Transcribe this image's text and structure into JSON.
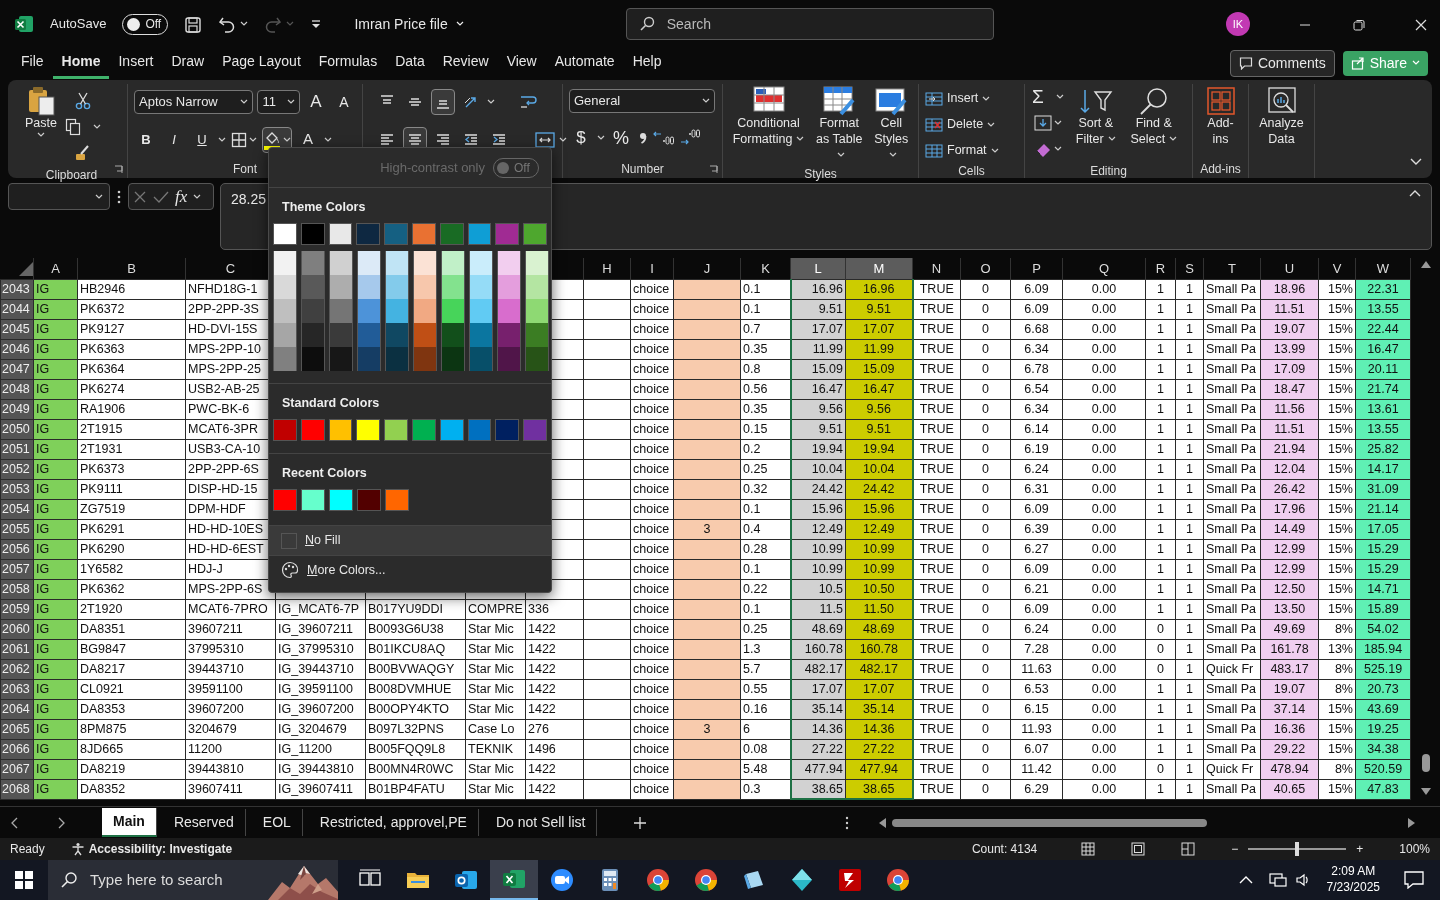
{
  "title_bar": {
    "autosave_label": "AutoSave",
    "autosave": {
      "on": false,
      "label": "Off"
    },
    "file_name": "Imran Price file",
    "search": {
      "placeholder": "Search"
    },
    "avatar": "IK"
  },
  "menu_tabs": [
    {
      "label": "File",
      "selected": false
    },
    {
      "label": "Home",
      "selected": true
    },
    {
      "label": "Insert",
      "selected": false
    },
    {
      "label": "Draw",
      "selected": false
    },
    {
      "label": "Page Layout",
      "selected": false
    },
    {
      "label": "Formulas",
      "selected": false
    },
    {
      "label": "Data",
      "selected": false
    },
    {
      "label": "Review",
      "selected": false
    },
    {
      "label": "View",
      "selected": false
    },
    {
      "label": "Automate",
      "selected": false
    },
    {
      "label": "Help",
      "selected": false
    }
  ],
  "header_buttons": {
    "comments": "Comments",
    "share": "Share"
  },
  "ribbon": {
    "clipboard": {
      "paste": "Paste",
      "group": "Clipboard"
    },
    "font": {
      "name": "Aptos Narrow",
      "size": "11",
      "grow": "A",
      "shrink": "A",
      "bold": "B",
      "italic": "I",
      "underline": "U",
      "font_color": "A",
      "fill_menu_open": true,
      "group": "Font"
    },
    "alignment": {
      "buttons": [
        {
          "kind": "top",
          "selected": false
        },
        {
          "kind": "middle",
          "selected": false
        },
        {
          "kind": "bottom",
          "selected": true
        },
        {
          "kind": "orientation",
          "selected": false
        },
        {
          "kind": "left",
          "selected": false
        },
        {
          "kind": "center",
          "selected": true
        },
        {
          "kind": "right",
          "selected": false
        },
        {
          "kind": "outdent",
          "selected": false
        },
        {
          "kind": "indent",
          "selected": false
        }
      ]
    },
    "number": {
      "format": "General",
      "currency": "$",
      "percent": "%",
      "group": "Number"
    },
    "styles": {
      "buttons": [
        "Conditional Formatting",
        "Format as Table",
        "Cell Styles"
      ],
      "group": "Styles"
    },
    "cells": {
      "buttons": [
        "Insert",
        "Delete",
        "Format"
      ],
      "group": "Cells"
    },
    "editing": {
      "sum": "Σ",
      "buttons": [
        "Sort & Filter",
        "Find & Select"
      ],
      "group": "Editing"
    },
    "addins": {
      "button": "Add-ins",
      "group": "Add-ins"
    },
    "analyze": {
      "button": "Analyze Data"
    }
  },
  "formula_bar": {
    "fx": "fx",
    "value": "28.25"
  },
  "fill_color_menu": {
    "high_contrast": {
      "label": "High-contrast only",
      "on": false,
      "state": "Off",
      "disabled": true
    },
    "theme_heading": "Theme Colors",
    "theme_colors": [
      {
        "color": "#ffffff",
        "shades": [
          {
            "color": "#f2f2f2"
          },
          {
            "color": "#d9d9d9"
          },
          {
            "color": "#bfbfbf"
          },
          {
            "color": "#a6a6a6"
          },
          {
            "color": "#808080"
          }
        ]
      },
      {
        "color": "#000000",
        "shades": [
          {
            "color": "#7f7f7f"
          },
          {
            "color": "#595959"
          },
          {
            "color": "#404040"
          },
          {
            "color": "#262626"
          },
          {
            "color": "#0d0d0d"
          }
        ]
      },
      {
        "color": "#e8e8e8",
        "shades": [
          {
            "color": "#d0d0d0"
          },
          {
            "color": "#adadad"
          },
          {
            "color": "#757575"
          },
          {
            "color": "#3a3a3a"
          },
          {
            "color": "#171717"
          }
        ]
      },
      {
        "color": "#0e2841",
        "shades": [
          {
            "color": "#dceaf7"
          },
          {
            "color": "#a6c9ec"
          },
          {
            "color": "#4d93d9"
          },
          {
            "color": "#215c98"
          },
          {
            "color": "#153d64"
          }
        ]
      },
      {
        "color": "#156082",
        "shades": [
          {
            "color": "#c0e4f5"
          },
          {
            "color": "#83cbeb"
          },
          {
            "color": "#44b3e1"
          },
          {
            "color": "#104862"
          },
          {
            "color": "#0b3041"
          }
        ]
      },
      {
        "color": "#e97132",
        "shades": [
          {
            "color": "#fbe2d5"
          },
          {
            "color": "#f7c7ac"
          },
          {
            "color": "#f1a983"
          },
          {
            "color": "#c04f15"
          },
          {
            "color": "#7f3510"
          }
        ]
      },
      {
        "color": "#196b24",
        "shades": [
          {
            "color": "#c1f0c8"
          },
          {
            "color": "#83e28e"
          },
          {
            "color": "#47d45a"
          },
          {
            "color": "#124f1b"
          },
          {
            "color": "#0c3512"
          }
        ]
      },
      {
        "color": "#0f9ed5",
        "shades": [
          {
            "color": "#caedfb"
          },
          {
            "color": "#95dcf7"
          },
          {
            "color": "#61cbf3"
          },
          {
            "color": "#0b76a0"
          },
          {
            "color": "#074f69"
          }
        ]
      },
      {
        "color": "#a02b93",
        "shades": [
          {
            "color": "#f2ceef"
          },
          {
            "color": "#e49edd"
          },
          {
            "color": "#d86dcd"
          },
          {
            "color": "#77206d"
          },
          {
            "color": "#501549"
          }
        ]
      },
      {
        "color": "#4ea72e",
        "shades": [
          {
            "color": "#d9f2d0"
          },
          {
            "color": "#b4e5a2"
          },
          {
            "color": "#8ed973"
          },
          {
            "color": "#3b7d23"
          },
          {
            "color": "#275317"
          }
        ]
      }
    ],
    "standard_heading": "Standard Colors",
    "standard_colors": [
      {
        "color": "#c00000"
      },
      {
        "color": "#ff0000"
      },
      {
        "color": "#ffc000"
      },
      {
        "color": "#ffff00"
      },
      {
        "color": "#92d050"
      },
      {
        "color": "#00b050"
      },
      {
        "color": "#00b0f0"
      },
      {
        "color": "#0070c0"
      },
      {
        "color": "#002060"
      },
      {
        "color": "#7030a0"
      }
    ],
    "recent_heading": "Recent Colors",
    "recent_colors": [
      {
        "color": "#ff0000"
      },
      {
        "color": "#66ffcc"
      },
      {
        "color": "#00ffff"
      },
      {
        "color": "#520000"
      },
      {
        "color": "#ff6600"
      }
    ],
    "no_fill": "No Fill",
    "more_colors": "More Colors..."
  },
  "sheet": {
    "columns": [
      {
        "label": "A",
        "selected": false,
        "color": "#7fd05a"
      },
      {
        "label": "B",
        "selected": false
      },
      {
        "label": "C",
        "selected": false
      },
      {},
      {},
      {},
      {},
      {
        "label": "H",
        "selected": false
      },
      {
        "label": "I",
        "selected": false
      },
      {
        "label": "J",
        "selected": false,
        "color": "#f8cbad"
      },
      {
        "label": "K",
        "selected": false
      },
      {
        "label": "L",
        "selected": true
      },
      {
        "label": "M",
        "selected": true,
        "color": "#cccc00"
      },
      {
        "label": "N",
        "selected": false
      },
      {
        "label": "O",
        "selected": false
      },
      {
        "label": "P",
        "selected": false
      },
      {
        "label": "Q",
        "selected": false
      },
      {
        "label": "R",
        "selected": false
      },
      {
        "label": "S",
        "selected": false
      },
      {
        "label": "T",
        "selected": false
      },
      {
        "label": "U",
        "selected": false,
        "color": "#f0cff0"
      },
      {
        "label": "V",
        "selected": false
      },
      {
        "label": "W",
        "selected": false,
        "color": "#5ff0b4"
      }
    ],
    "rows": [
      {
        "number": "2043",
        "cells": [
          "IG",
          "HB2946",
          "NFHD18G-1",
          null,
          null,
          null,
          null,
          null,
          "choice",
          null,
          "0.1",
          "16.96",
          "16.96",
          "TRUE",
          "0",
          "6.09",
          "0.00",
          "1",
          "1",
          "Small Pa",
          "18.96",
          "15%",
          "22.31"
        ]
      },
      {
        "number": "2044",
        "cells": [
          "IG",
          "PK6372",
          "2PP-2PP-3S",
          null,
          null,
          null,
          null,
          null,
          "choice",
          null,
          "0.1",
          "9.51",
          "9.51",
          "TRUE",
          "0",
          "6.09",
          "0.00",
          "1",
          "1",
          "Small Pa",
          "11.51",
          "15%",
          "13.55"
        ]
      },
      {
        "number": "2045",
        "cells": [
          "IG",
          "PK9127",
          "HD-DVI-15S",
          null,
          null,
          null,
          null,
          null,
          "choice",
          null,
          "0.7",
          "17.07",
          "17.07",
          "TRUE",
          "0",
          "6.68",
          "0.00",
          "1",
          "1",
          "Small Pa",
          "19.07",
          "15%",
          "22.44"
        ]
      },
      {
        "number": "2046",
        "cells": [
          "IG",
          "PK6363",
          "MPS-2PP-10",
          null,
          null,
          null,
          null,
          null,
          "choice",
          null,
          "0.35",
          "11.99",
          "11.99",
          "TRUE",
          "0",
          "6.34",
          "0.00",
          "1",
          "1",
          "Small Pa",
          "13.99",
          "15%",
          "16.47"
        ]
      },
      {
        "number": "2047",
        "cells": [
          "IG",
          "PK6364",
          "MPS-2PP-25",
          null,
          null,
          null,
          null,
          null,
          "choice",
          null,
          "0.8",
          "15.09",
          "15.09",
          "TRUE",
          "0",
          "6.78",
          "0.00",
          "1",
          "1",
          "Small Pa",
          "17.09",
          "15%",
          "20.11"
        ]
      },
      {
        "number": "2048",
        "cells": [
          "IG",
          "PK6274",
          "USB2-AB-25",
          null,
          null,
          null,
          null,
          null,
          "choice",
          null,
          "0.56",
          "16.47",
          "16.47",
          "TRUE",
          "0",
          "6.54",
          "0.00",
          "1",
          "1",
          "Small Pa",
          "18.47",
          "15%",
          "21.74"
        ]
      },
      {
        "number": "2049",
        "cells": [
          "IG",
          "RA1906",
          "PWC-BK-6",
          null,
          null,
          null,
          null,
          null,
          "choice",
          null,
          "0.35",
          "9.56",
          "9.56",
          "TRUE",
          "0",
          "6.34",
          "0.00",
          "1",
          "1",
          "Small Pa",
          "11.56",
          "15%",
          "13.61"
        ]
      },
      {
        "number": "2050",
        "cells": [
          "IG",
          "2T1915",
          "MCAT6-3PR",
          null,
          null,
          null,
          null,
          null,
          "choice",
          null,
          "0.15",
          "9.51",
          "9.51",
          "TRUE",
          "0",
          "6.14",
          "0.00",
          "1",
          "1",
          "Small Pa",
          "11.51",
          "15%",
          "13.55"
        ]
      },
      {
        "number": "2051",
        "cells": [
          "IG",
          "2T1931",
          "USB3-CA-10",
          null,
          null,
          null,
          null,
          null,
          "choice",
          null,
          "0.2",
          "19.94",
          "19.94",
          "TRUE",
          "0",
          "6.19",
          "0.00",
          "1",
          "1",
          "Small Pa",
          "21.94",
          "15%",
          "25.82"
        ]
      },
      {
        "number": "2052",
        "cells": [
          "IG",
          "PK6373",
          "2PP-2PP-6S",
          null,
          null,
          null,
          null,
          null,
          "choice",
          null,
          "0.25",
          "10.04",
          "10.04",
          "TRUE",
          "0",
          "6.24",
          "0.00",
          "1",
          "1",
          "Small Pa",
          "12.04",
          "15%",
          "14.17"
        ]
      },
      {
        "number": "2053",
        "cells": [
          "IG",
          "PK9111",
          "DISP-HD-15",
          null,
          null,
          null,
          null,
          null,
          "choice",
          null,
          "0.32",
          "24.42",
          "24.42",
          "TRUE",
          "0",
          "6.31",
          "0.00",
          "1",
          "1",
          "Small Pa",
          "26.42",
          "15%",
          "31.09"
        ]
      },
      {
        "number": "2054",
        "cells": [
          "IG",
          "ZG7519",
          "DPM-HDF",
          null,
          null,
          null,
          null,
          null,
          "choice",
          null,
          "0.1",
          "15.96",
          "15.96",
          "TRUE",
          "0",
          "6.09",
          "0.00",
          "1",
          "1",
          "Small Pa",
          "17.96",
          "15%",
          "21.14"
        ]
      },
      {
        "number": "2055",
        "cells": [
          "IG",
          "PK6291",
          "HD-HD-10ES",
          null,
          null,
          null,
          null,
          null,
          "choice",
          "3",
          "0.4",
          "12.49",
          "12.49",
          "TRUE",
          "0",
          "6.39",
          "0.00",
          "1",
          "1",
          "Small Pa",
          "14.49",
          "15%",
          "17.05"
        ]
      },
      {
        "number": "2056",
        "cells": [
          "IG",
          "PK6290",
          "HD-HD-6EST",
          null,
          null,
          null,
          null,
          null,
          "choice",
          null,
          "0.28",
          "10.99",
          "10.99",
          "TRUE",
          "0",
          "6.27",
          "0.00",
          "1",
          "1",
          "Small Pa",
          "12.99",
          "15%",
          "15.29"
        ]
      },
      {
        "number": "2057",
        "cells": [
          "IG",
          "1Y6582",
          "HDJ-J",
          null,
          null,
          null,
          null,
          null,
          "choice",
          null,
          "0.1",
          "10.99",
          "10.99",
          "TRUE",
          "0",
          "6.09",
          "0.00",
          "1",
          "1",
          "Small Pa",
          "12.99",
          "15%",
          "15.29"
        ]
      },
      {
        "number": "2058",
        "cells": [
          "IG",
          "PK6362",
          "MPS-2PP-6S",
          null,
          null,
          null,
          null,
          null,
          "choice",
          null,
          "0.22",
          "10.5",
          "10.50",
          "TRUE",
          "0",
          "6.21",
          "0.00",
          "1",
          "1",
          "Small Pa",
          "12.50",
          "15%",
          "14.71"
        ]
      },
      {
        "number": "2059",
        "cells": [
          "IG",
          "2T1920",
          "MCAT6-7PRO",
          "IG_MCAT6-7P",
          "B017YU9DDI",
          "COMPRE",
          "336",
          null,
          "choice",
          null,
          "0.1",
          "11.5",
          "11.50",
          "TRUE",
          "0",
          "6.09",
          "0.00",
          "1",
          "1",
          "Small Pa",
          "13.50",
          "15%",
          "15.89"
        ]
      },
      {
        "number": "2060",
        "cells": [
          "IG",
          "DA8351",
          "39607211",
          "IG_39607211",
          "B0093G6U38",
          "Star Mic",
          "1422",
          null,
          "choice",
          null,
          "0.25",
          "48.69",
          "48.69",
          "TRUE",
          "0",
          "6.24",
          "0.00",
          "0",
          "1",
          "Small Pa",
          "49.69",
          "8%",
          "54.02"
        ]
      },
      {
        "number": "2061",
        "cells": [
          "IG",
          "BG9847",
          "37995310",
          "IG_37995310",
          "B01IKCU8AQ",
          "Star Mic",
          "1422",
          null,
          "choice",
          null,
          "1.3",
          "160.78",
          "160.78",
          "TRUE",
          "0",
          "7.28",
          "0.00",
          "0",
          "1",
          "Small Pa",
          "161.78",
          "13%",
          "185.94"
        ]
      },
      {
        "number": "2062",
        "cells": [
          "IG",
          "DA8217",
          "39443710",
          "IG_39443710",
          "B00BVWAQGY",
          "Star Mic",
          "1422",
          null,
          "choice",
          null,
          "5.7",
          "482.17",
          "482.17",
          "TRUE",
          "0",
          "11.63",
          "0.00",
          "0",
          "1",
          "Quick Fr",
          "483.17",
          "8%",
          "525.19"
        ]
      },
      {
        "number": "2063",
        "cells": [
          "IG",
          "CL0921",
          "39591100",
          "IG_39591100",
          "B008DVMHUE",
          "Star Mic",
          "1422",
          null,
          "choice",
          null,
          "0.55",
          "17.07",
          "17.07",
          "TRUE",
          "0",
          "6.53",
          "0.00",
          "1",
          "1",
          "Small Pa",
          "19.07",
          "8%",
          "20.73"
        ]
      },
      {
        "number": "2064",
        "cells": [
          "IG",
          "DA8353",
          "39607200",
          "IG_39607200",
          "B00OPY4KTO",
          "Star Mic",
          "1422",
          null,
          "choice",
          null,
          "0.16",
          "35.14",
          "35.14",
          "TRUE",
          "0",
          "6.15",
          "0.00",
          "1",
          "1",
          "Small Pa",
          "37.14",
          "15%",
          "43.69"
        ]
      },
      {
        "number": "2065",
        "cells": [
          "IG",
          "8PM875",
          "3204679",
          "IG_3204679",
          "B097L32PNS",
          "Case Lo",
          "276",
          null,
          "choice",
          "3",
          "6",
          "14.36",
          "14.36",
          "TRUE",
          "0",
          "11.93",
          "0.00",
          "1",
          "1",
          "Small Pa",
          "16.36",
          "15%",
          "19.25"
        ]
      },
      {
        "number": "2066",
        "cells": [
          "IG",
          "8JD665",
          "11200",
          "IG_11200",
          "B005FQQ9L8",
          "TEKNIK",
          "1496",
          null,
          "choice",
          null,
          "0.08",
          "27.22",
          "27.22",
          "TRUE",
          "0",
          "6.07",
          "0.00",
          "1",
          "1",
          "Small Pa",
          "29.22",
          "15%",
          "34.38"
        ]
      },
      {
        "number": "2067",
        "cells": [
          "IG",
          "DA8219",
          "39443810",
          "IG_39443810",
          "B00MN4R0WC",
          "Star Mic",
          "1422",
          null,
          "choice",
          null,
          "5.48",
          "477.94",
          "477.94",
          "TRUE",
          "0",
          "11.42",
          "0.00",
          "0",
          "1",
          "Quick Fr",
          "478.94",
          "8%",
          "520.59"
        ]
      },
      {
        "number": "2068",
        "cells": [
          "IG",
          "DA8352",
          "39607411",
          "IG_39607411",
          "B01BP4FATU",
          "Star Mic",
          "1422",
          null,
          "choice",
          null,
          "0.3",
          "38.65",
          "38.65",
          "TRUE",
          "0",
          "6.29",
          "0.00",
          "1",
          "1",
          "Small Pa",
          "40.65",
          "15%",
          "47.83"
        ]
      }
    ]
  },
  "sheet_tabs": [
    {
      "label": "Main",
      "selected": true
    },
    {
      "label": "Reserved",
      "selected": false
    },
    {
      "label": "EOL",
      "selected": false
    },
    {
      "label": "Restricted, approvel,PE",
      "selected": false
    },
    {
      "label": "Do not Sell list",
      "selected": false
    }
  ],
  "status_bar": {
    "mode": "Ready",
    "accessibility": "Accessibility: Investigate",
    "count": "Count: 4134",
    "zoom_out": "−",
    "zoom_in": "+",
    "zoom": {
      "level": 0.5
    },
    "zoom_percent": "100%"
  },
  "taskbar": {
    "search": {
      "placeholder": "Type here to search"
    },
    "apps": [
      {
        "kind": "task-view",
        "selected": false
      },
      {
        "kind": "folder",
        "selected": false
      },
      {
        "kind": "mail",
        "selected": false
      },
      {
        "kind": "spreadsheet",
        "selected": true
      },
      {
        "kind": "video",
        "selected": false
      },
      {
        "kind": "calculator",
        "selected": false
      },
      {
        "kind": "browser",
        "selected": false
      },
      {
        "kind": "browser",
        "selected": false
      },
      {
        "kind": "notes",
        "selected": false
      },
      {
        "kind": "cube",
        "selected": false
      },
      {
        "kind": "ftp",
        "selected": false
      },
      {
        "kind": "browser",
        "selected": false
      }
    ],
    "time": "2:09 AM",
    "date": "7/23/2025"
  }
}
